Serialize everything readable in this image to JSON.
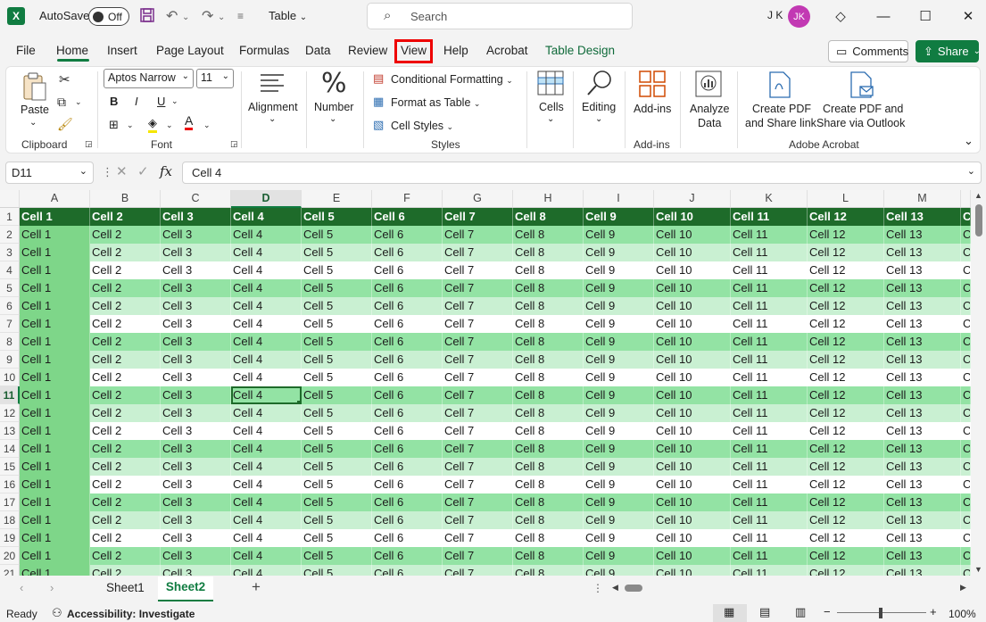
{
  "titlebar": {
    "logo": "X",
    "autosave_label": "AutoSave",
    "autosave_state": "Off",
    "doc_title": "Table",
    "search_placeholder": "Search",
    "user_initials": "J K",
    "avatar_initials": "JK"
  },
  "tabs": [
    {
      "label": "File"
    },
    {
      "label": "Home"
    },
    {
      "label": "Insert"
    },
    {
      "label": "Page Layout"
    },
    {
      "label": "Formulas"
    },
    {
      "label": "Data"
    },
    {
      "label": "Review"
    },
    {
      "label": "View"
    },
    {
      "label": "Help"
    },
    {
      "label": "Acrobat"
    },
    {
      "label": "Table Design"
    }
  ],
  "active_tab": "Home",
  "header_buttons": {
    "comments": "Comments",
    "share": "Share"
  },
  "ribbon": {
    "clipboard": {
      "paste": "Paste",
      "label": "Clipboard"
    },
    "font": {
      "name": "Aptos Narrow",
      "size": "11",
      "label": "Font",
      "bold": "B",
      "italic": "I",
      "underline": "U"
    },
    "alignment": {
      "label": "Alignment"
    },
    "number": {
      "label": "Number",
      "glyph": "%"
    },
    "styles": {
      "conditional": "Conditional Formatting",
      "format_table": "Format as Table",
      "cell_styles": "Cell Styles",
      "label": "Styles"
    },
    "cells": {
      "label": "Cells"
    },
    "editing": {
      "label": "Editing"
    },
    "addins": {
      "button": "Add-ins",
      "label": "Add-ins"
    },
    "analyze": {
      "line1": "Analyze",
      "line2": "Data"
    },
    "acrobat": {
      "pdf1_line1": "Create PDF",
      "pdf1_line2": "and Share link",
      "pdf2_line1": "Create PDF and",
      "pdf2_line2": "Share via Outlook",
      "label": "Adobe Acrobat"
    }
  },
  "formula_bar": {
    "name_box": "D11",
    "fx": "fx",
    "content": "Cell 4"
  },
  "grid": {
    "columns": [
      "A",
      "B",
      "C",
      "D",
      "E",
      "F",
      "G",
      "H",
      "I",
      "J",
      "K",
      "L",
      "M"
    ],
    "selected_column": "D",
    "selected_row": 11,
    "header_row": [
      "Cell 1",
      "Cell 2",
      "Cell 3",
      "Cell 4",
      "Cell 5",
      "Cell 6",
      "Cell 7",
      "Cell 8",
      "Cell 9",
      "Cell 10",
      "Cell 11",
      "Cell 12",
      "Cell 13",
      "C"
    ],
    "data_row": [
      "Cell 1",
      "Cell 2",
      "Cell 3",
      "Cell 4",
      "Cell 5",
      "Cell 6",
      "Cell 7",
      "Cell 8",
      "Cell 9",
      "Cell 10",
      "Cell 11",
      "Cell 12",
      "Cell 13",
      "C"
    ],
    "row_numbers": [
      1,
      2,
      3,
      4,
      5,
      6,
      7,
      8,
      9,
      10,
      11,
      12,
      13,
      14,
      15,
      16,
      17,
      18,
      19,
      20,
      21
    ]
  },
  "sheets": [
    {
      "name": "Sheet1"
    },
    {
      "name": "Sheet2"
    }
  ],
  "active_sheet": "Sheet2",
  "status": {
    "ready": "Ready",
    "accessibility": "Accessibility: Investigate",
    "zoom": "100%"
  },
  "colors": {
    "accent": "#107c41",
    "table_header": "#1e6b2a",
    "band_dark": "#93e3a4",
    "band_light": "#c9f0d2",
    "highlight": "#e00000"
  }
}
